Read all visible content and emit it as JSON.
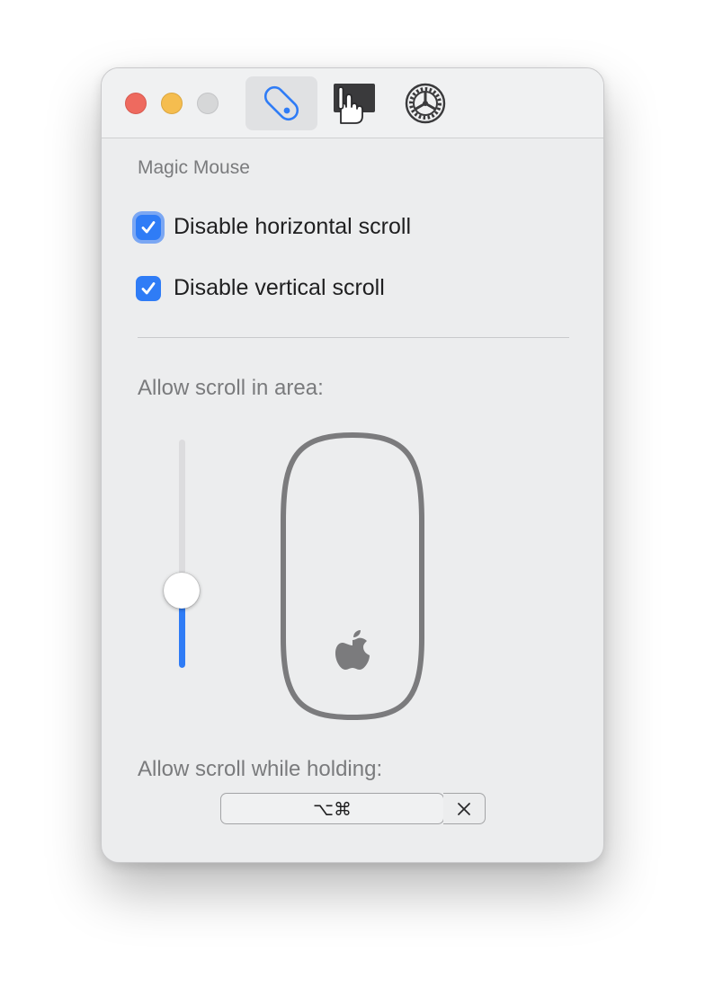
{
  "toolbar": {
    "tabs": [
      {
        "icon": "mouse-icon",
        "selected": true
      },
      {
        "icon": "trackpad-icon",
        "selected": false
      },
      {
        "icon": "gear-icon",
        "selected": false
      }
    ]
  },
  "section": {
    "title": "Magic Mouse"
  },
  "options": {
    "disable_horizontal": {
      "label": "Disable horizontal scroll",
      "checked": true
    },
    "disable_vertical": {
      "label": "Disable vertical scroll",
      "checked": true
    }
  },
  "scroll_area": {
    "label": "Allow scroll in area:",
    "slider_value": 0.34
  },
  "modifier": {
    "label": "Allow scroll while holding:",
    "shortcut": "⌥⌘"
  },
  "colors": {
    "accent": "#2f7cf6",
    "close": "#ee6a5f",
    "minimize": "#f5bd4f",
    "zoom": "#d6d7d8"
  }
}
